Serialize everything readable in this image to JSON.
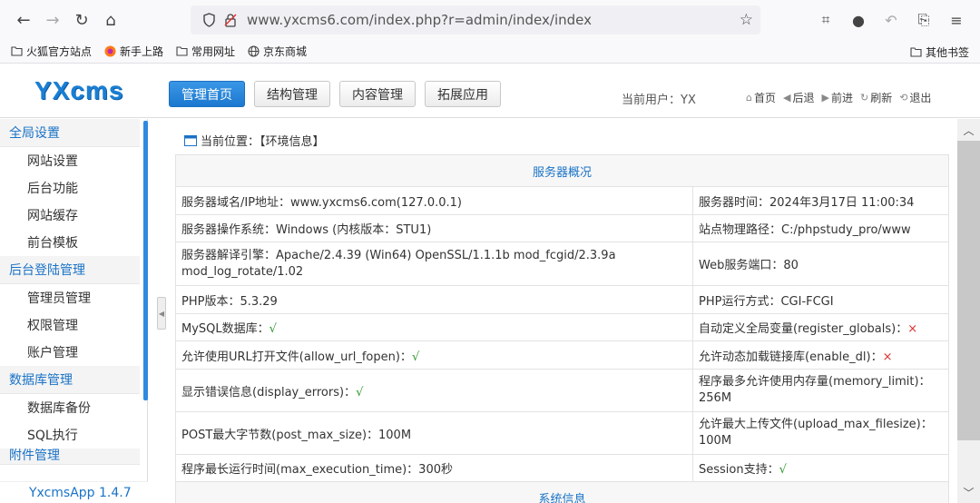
{
  "browser": {
    "url": "www.yxcms6.com/index.php?r=admin/index/index",
    "bookmarks": [
      "火狐官方站点",
      "新手上路",
      "常用网址",
      "京东商城"
    ],
    "other_bookmarks": "其他书签"
  },
  "header": {
    "logo": "YXcms",
    "tabs": [
      {
        "label": "管理首页",
        "active": true
      },
      {
        "label": "结构管理",
        "active": false
      },
      {
        "label": "内容管理",
        "active": false
      },
      {
        "label": "拓展应用",
        "active": false
      }
    ],
    "current_user": "当前用户：YX",
    "actions": [
      "首页",
      "后退",
      "前进",
      "刷新",
      "退出"
    ]
  },
  "sidebar": {
    "sections": [
      {
        "title": "全局设置",
        "items": [
          "网站设置",
          "后台功能",
          "网站缓存",
          "前台模板"
        ]
      },
      {
        "title": "后台登陆管理",
        "items": [
          "管理员管理",
          "权限管理",
          "账户管理"
        ]
      },
      {
        "title": "数据库管理",
        "items": [
          "数据库备份",
          "SQL执行"
        ]
      },
      {
        "title": "附件管理",
        "items": []
      }
    ],
    "footer": "YxcmsApp 1.4.7"
  },
  "content": {
    "breadcrumb": "当前位置：【环境信息】",
    "table_caption": "服务器概况",
    "next_caption": "系统信息",
    "rows": [
      [
        "服务器域名/IP地址：www.yxcms6.com(127.0.0.1)",
        "服务器时间：2024年3月17日 11:00:34"
      ],
      [
        "服务器操作系统：Windows (内核版本：STU1)",
        "站点物理路径：C:/phpstudy_pro/www"
      ],
      [
        "服务器解译引擎：Apache/2.4.39 (Win64) OpenSSL/1.1.1b mod_fcgid/2.3.9a mod_log_rotate/1.02",
        "Web服务端口：80"
      ],
      [
        "PHP版本：5.3.29",
        "PHP运行方式：CGI-FCGI"
      ],
      [
        "MySQL数据库：",
        "自动定义全局变量(register_globals)："
      ],
      [
        "允许使用URL打开文件(allow_url_fopen)：",
        "允许动态加载链接库(enable_dl)："
      ],
      [
        "显示错误信息(display_errors)：",
        "程序最多允许使用内存量(memory_limit)：256M"
      ],
      [
        "POST最大字节数(post_max_size)：100M",
        "允许最大上传文件(upload_max_filesize)：100M"
      ],
      [
        "程序最长运行时间(max_execution_time)：300秒",
        "Session支持："
      ]
    ],
    "check": "√",
    "cross": "×"
  }
}
